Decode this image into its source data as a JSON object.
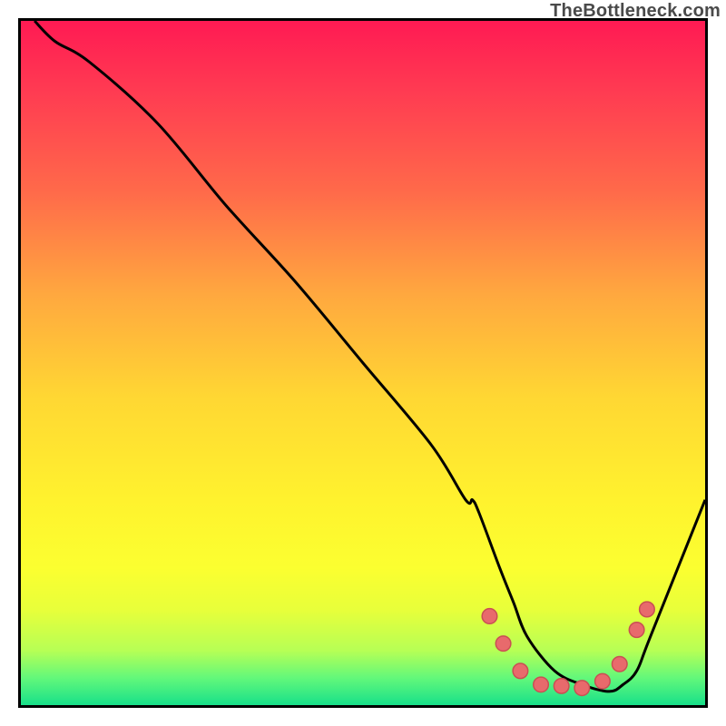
{
  "watermark": "TheBottleneck.com",
  "chart_data": {
    "type": "line",
    "title": "",
    "xlabel": "",
    "ylabel": "",
    "xlim": [
      0,
      100
    ],
    "ylim": [
      0,
      100
    ],
    "grid": false,
    "legend": false,
    "series": [
      {
        "name": "curve",
        "x": [
          2,
          5,
          10,
          20,
          30,
          40,
          50,
          60,
          65,
          66,
          67,
          70,
          72,
          74,
          78,
          82,
          86,
          88,
          90,
          92,
          100
        ],
        "y": [
          100,
          97,
          94,
          85,
          73,
          62,
          50,
          38,
          30,
          30,
          28,
          20,
          15,
          10,
          5,
          3,
          2,
          3,
          5,
          10,
          30
        ]
      }
    ],
    "points": [
      {
        "x": 68.5,
        "y": 13.0
      },
      {
        "x": 70.5,
        "y": 9.0
      },
      {
        "x": 73.0,
        "y": 5.0
      },
      {
        "x": 76.0,
        "y": 3.0
      },
      {
        "x": 79.0,
        "y": 2.8
      },
      {
        "x": 82.0,
        "y": 2.5
      },
      {
        "x": 85.0,
        "y": 3.5
      },
      {
        "x": 87.5,
        "y": 6.0
      },
      {
        "x": 90.0,
        "y": 11.0
      },
      {
        "x": 91.5,
        "y": 14.0
      }
    ],
    "gradient_stops": [
      {
        "pct": 0,
        "color": "#ff1a53"
      },
      {
        "pct": 10,
        "color": "#ff3a52"
      },
      {
        "pct": 25,
        "color": "#ff6a4a"
      },
      {
        "pct": 40,
        "color": "#ffa83f"
      },
      {
        "pct": 55,
        "color": "#ffd733"
      },
      {
        "pct": 70,
        "color": "#fff22e"
      },
      {
        "pct": 80,
        "color": "#fbff30"
      },
      {
        "pct": 86,
        "color": "#e8ff3a"
      },
      {
        "pct": 92,
        "color": "#b7ff55"
      },
      {
        "pct": 96,
        "color": "#63f87a"
      },
      {
        "pct": 100,
        "color": "#18e08a"
      }
    ]
  }
}
